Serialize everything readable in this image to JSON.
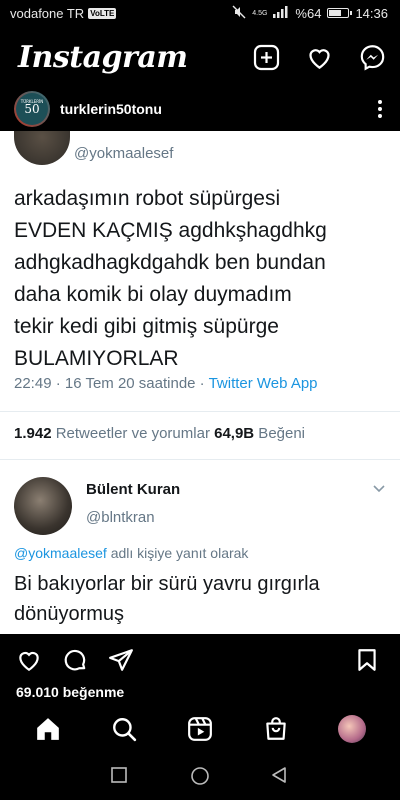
{
  "status_bar": {
    "carrier": "vodafone TR",
    "volte": "VoLTE",
    "network": "4.5G",
    "battery": "%64",
    "battery_level": 0.64,
    "time": "14:36"
  },
  "app": {
    "title": "Instagram",
    "icons": [
      "new-post-icon",
      "heart-icon",
      "messenger-icon"
    ]
  },
  "post": {
    "username": "turklerin50tonu",
    "avatar_text": "TÜRKLERİN 50 TONU",
    "likes": "69.010 beğenme"
  },
  "tweet": {
    "handle": "@yokmaalesef",
    "text_lines": [
      "arkadaşımın robot süpürgesi",
      "EVDEN KAÇMIŞ agdhkşhagdhkg",
      "adhgkadhagkdgahdk ben bundan",
      "daha komik bi olay duymadım",
      "tekir kedi gibi gitmiş süpürge",
      "BULAMIYORLAR"
    ],
    "meta": "22:49 · 16 Tem 20 saatinde · ",
    "source": "Twitter Web App",
    "retweets": "1.942",
    "retweets_label": " Retweetler ve yorumlar  ",
    "likes": "64,9B",
    "likes_label": " Beğeni"
  },
  "reply": {
    "name": "Bülent Kuran",
    "handle": "@blntkran",
    "reply_mention": "@yokmaalesef",
    "reply_suffix": " adlı kişiye yanıt olarak",
    "text_lines": [
      "Bi bakıyorlar bir sürü yavru gırgırla",
      "dönüyormuş"
    ]
  },
  "bottom_nav": [
    "home-icon",
    "search-icon",
    "reels-icon",
    "shop-icon",
    "profile-avatar"
  ],
  "system_nav": [
    "recent-apps-icon",
    "home-circle-icon",
    "back-icon"
  ]
}
